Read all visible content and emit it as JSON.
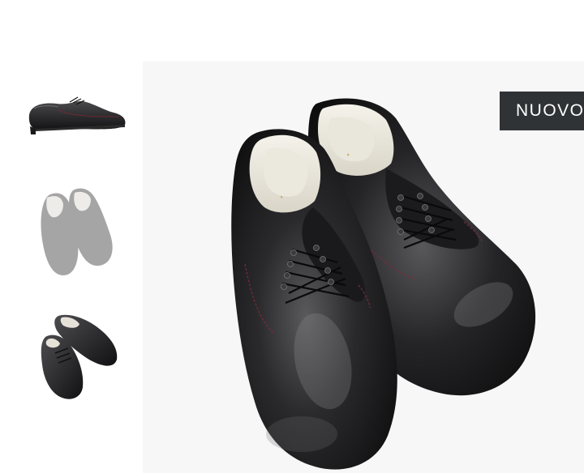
{
  "gallery": {
    "thumbnails": [
      {
        "view": "side",
        "state": "default"
      },
      {
        "view": "top-pair",
        "state": "faded"
      },
      {
        "view": "angled-pair",
        "state": "default"
      }
    ],
    "main_view": "top-pair"
  },
  "badge": {
    "label": "NUOVO",
    "background": "#2f3336",
    "text_color": "#ffffff"
  },
  "colors": {
    "leather": "#1c1c1e",
    "stitching": "#7a2a33",
    "lining": "#ece9df",
    "stage": "#f7f7f7"
  }
}
